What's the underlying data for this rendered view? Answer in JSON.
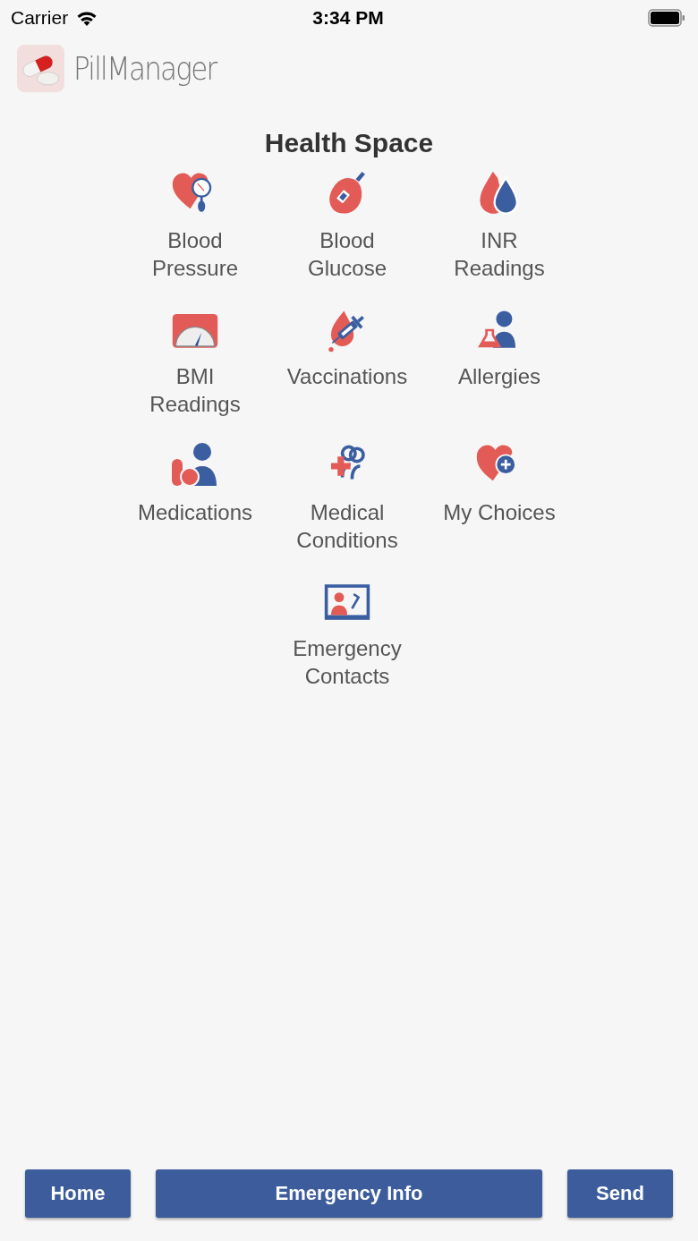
{
  "status_bar": {
    "carrier": "Carrier",
    "time": "3:34 PM"
  },
  "app": {
    "title": "PillManager"
  },
  "section": {
    "title": "Health Space"
  },
  "items": [
    {
      "label": "Blood\nPressure"
    },
    {
      "label": "Blood\nGlucose"
    },
    {
      "label": "INR\nReadings"
    },
    {
      "label": "BMI\nReadings"
    },
    {
      "label": "Vaccinations"
    },
    {
      "label": "Allergies"
    },
    {
      "label": "Medications"
    },
    {
      "label": "Medical\nConditions"
    },
    {
      "label": "My Choices"
    },
    {
      "label": "Emergency\nContacts"
    }
  ],
  "buttons": [
    "Home",
    "Emergency Info",
    "Send"
  ]
}
